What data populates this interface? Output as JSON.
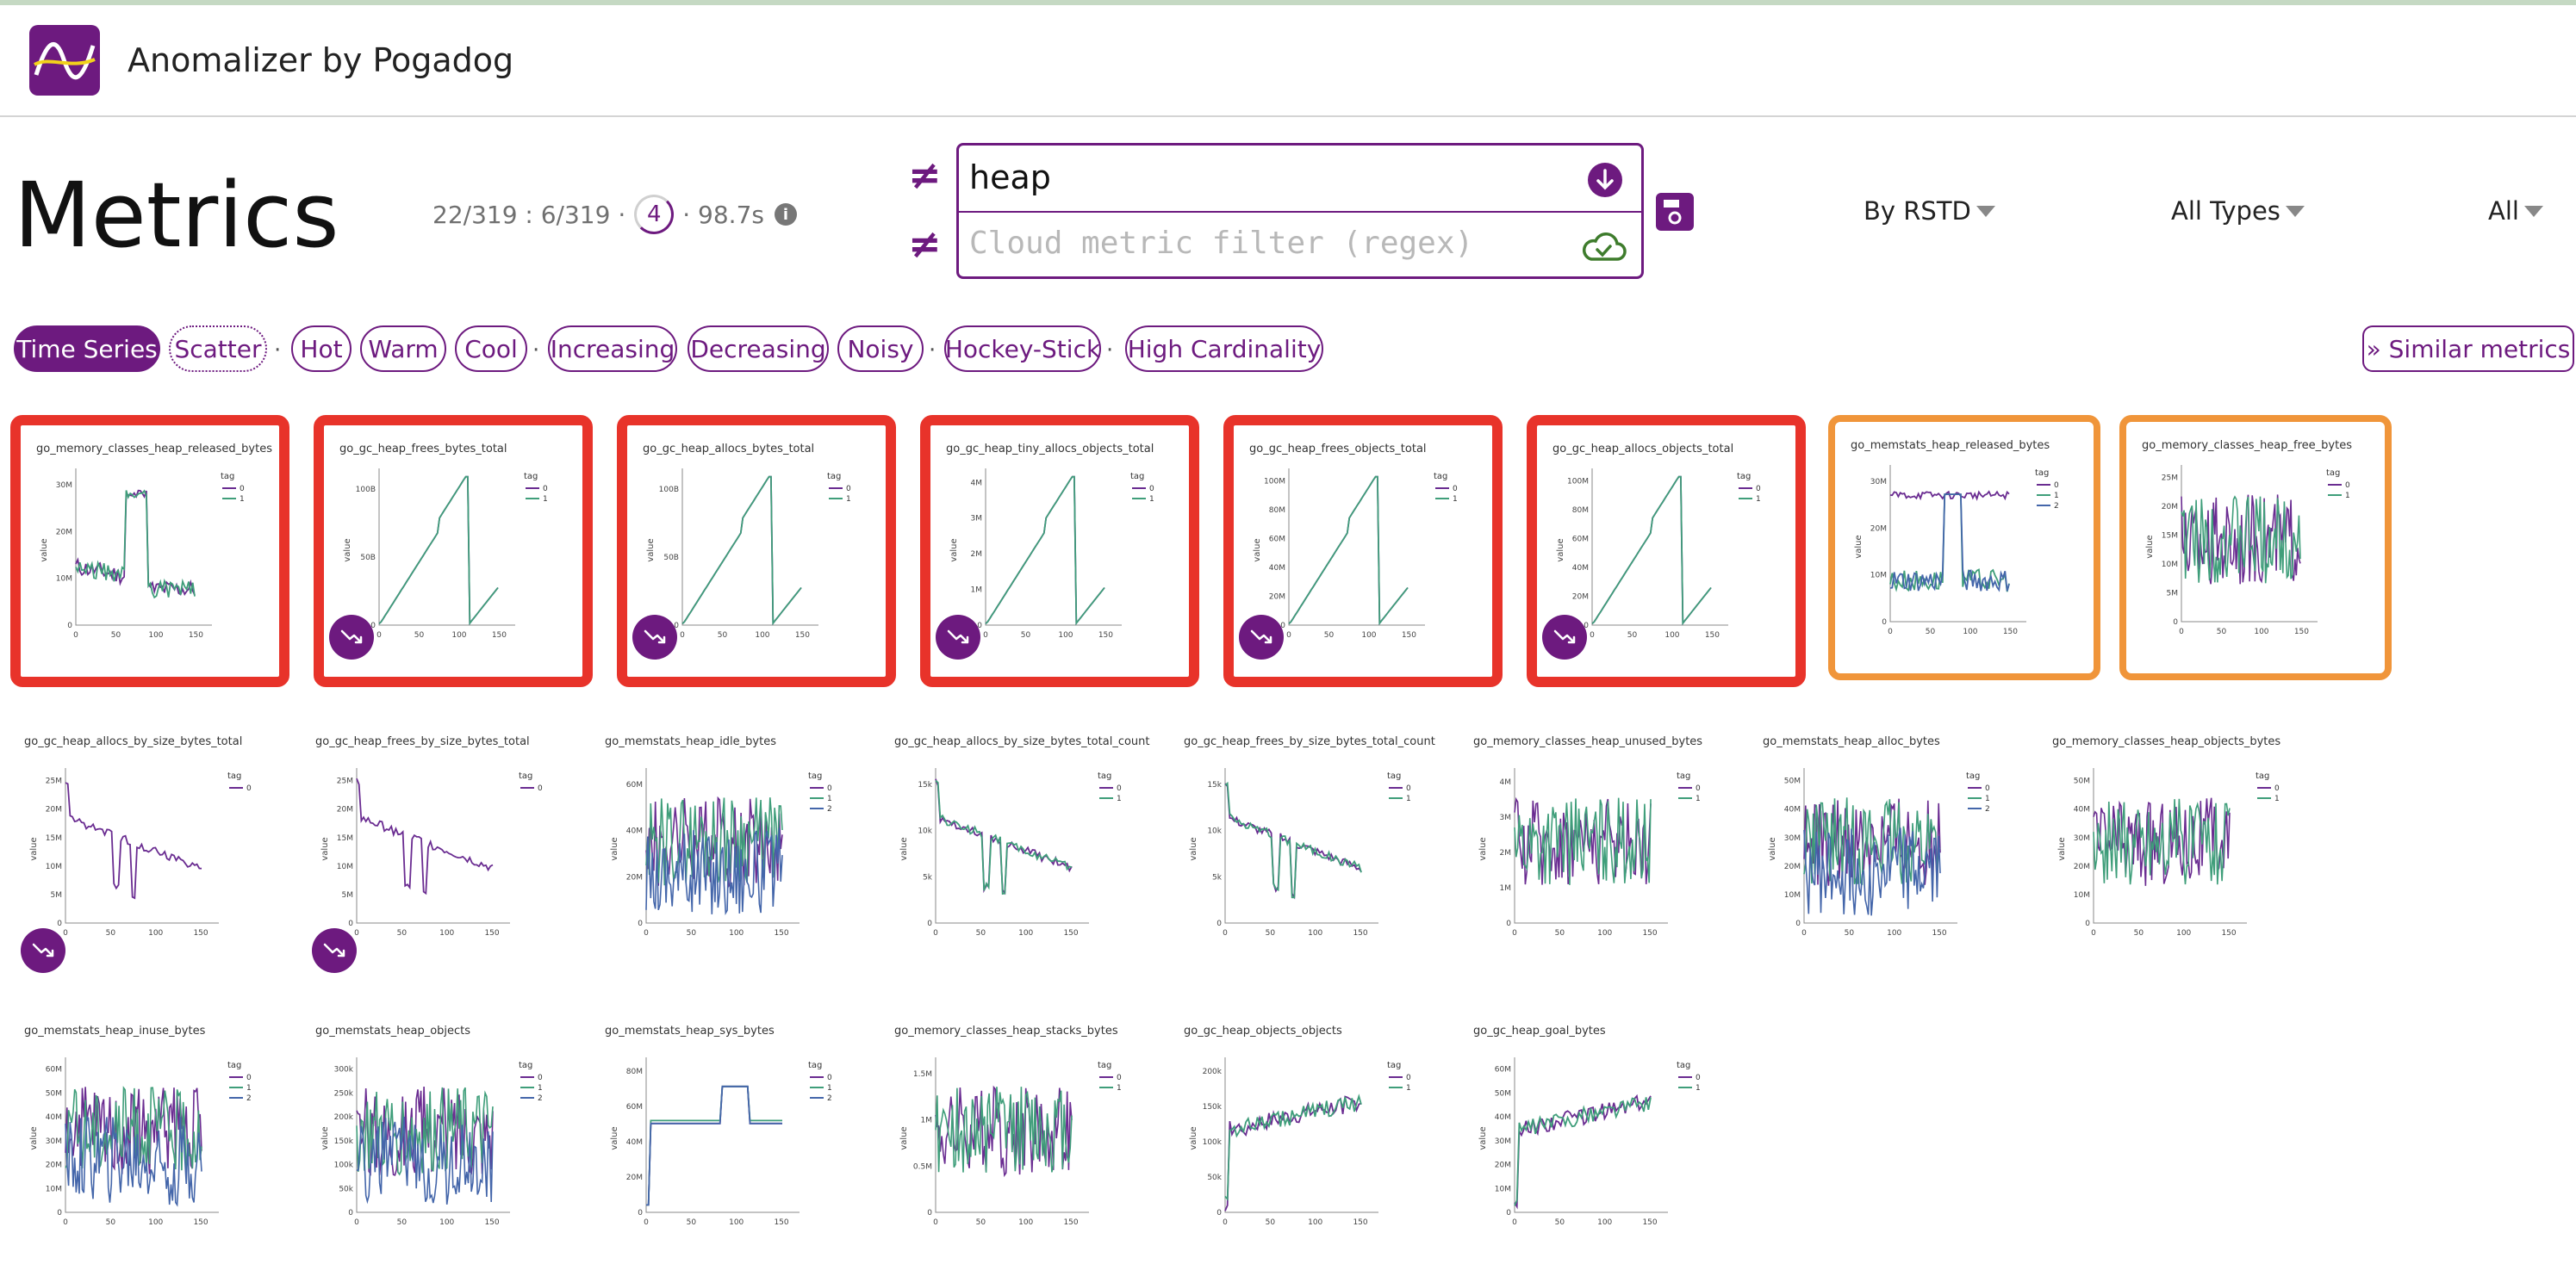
{
  "header": {
    "app_title": "Anomalizer by Pogadog"
  },
  "page": {
    "title": "Metrics"
  },
  "stats": {
    "counts": "22/319 : 6/319 ·",
    "ring_value": "4",
    "duration": "· 98.7s"
  },
  "filters": {
    "primary_value": "heap",
    "cloud_placeholder": "Cloud metric filter (regex)"
  },
  "dropdowns": {
    "sort": "By RSTD",
    "types": "All Types",
    "scope": "All"
  },
  "chips": [
    {
      "label": "Time Series"
    },
    {
      "label": "Scatter"
    },
    {
      "label": "Hot"
    },
    {
      "label": "Warm"
    },
    {
      "label": "Cool"
    },
    {
      "label": "Increasing"
    },
    {
      "label": "Decreasing"
    },
    {
      "label": "Noisy"
    },
    {
      "label": "Hockey-Stick"
    },
    {
      "label": "High Cardinality"
    }
  ],
  "separator": "·",
  "similar_button": "» Similar metrics",
  "legend": {
    "title": "tag",
    "labels": [
      "0",
      "1",
      "2"
    ]
  },
  "axis": {
    "ylabel": "value",
    "xticks": [
      "0",
      "50",
      "100",
      "150"
    ]
  },
  "colors": {
    "brand": "#6d1a7f",
    "red": "#e8332a",
    "orange": "#f0953a",
    "series": [
      "#6a2c91",
      "#3f9e7a",
      "#4466aa"
    ]
  },
  "metrics": [
    {
      "name": "go_memory_classes_heap_released_bytes",
      "yticks": [
        "10M",
        "20M",
        "30M"
      ],
      "series": 2,
      "shape": "step",
      "highlight": "red",
      "badge": false
    },
    {
      "name": "go_gc_heap_frees_bytes_total",
      "yticks": [
        "50B",
        "100B"
      ],
      "series": 2,
      "shape": "saw",
      "highlight": "red",
      "badge": true
    },
    {
      "name": "go_gc_heap_allocs_bytes_total",
      "yticks": [
        "50B",
        "100B"
      ],
      "series": 2,
      "shape": "saw",
      "highlight": "red",
      "badge": true
    },
    {
      "name": "go_gc_heap_tiny_allocs_objects_total",
      "yticks": [
        "1M",
        "2M",
        "3M",
        "4M"
      ],
      "series": 2,
      "shape": "saw",
      "highlight": "red",
      "badge": true
    },
    {
      "name": "go_gc_heap_frees_objects_total",
      "yticks": [
        "20M",
        "40M",
        "60M",
        "80M",
        "100M"
      ],
      "series": 2,
      "shape": "saw",
      "highlight": "red",
      "badge": true
    },
    {
      "name": "go_gc_heap_allocs_objects_total",
      "yticks": [
        "20M",
        "40M",
        "60M",
        "80M",
        "100M"
      ],
      "series": 2,
      "shape": "saw",
      "highlight": "red",
      "badge": true
    },
    {
      "name": "go_memstats_heap_released_bytes",
      "yticks": [
        "10M",
        "20M",
        "30M"
      ],
      "series": 3,
      "shape": "step2",
      "highlight": "orange",
      "badge": false
    },
    {
      "name": "go_memory_classes_heap_free_bytes",
      "yticks": [
        "5M",
        "10M",
        "15M",
        "20M",
        "25M"
      ],
      "series": 2,
      "shape": "noise",
      "highlight": "orange",
      "badge": false
    },
    {
      "name": "go_gc_heap_allocs_by_size_bytes_total",
      "yticks": [
        "5M",
        "10M",
        "15M",
        "20M",
        "25M"
      ],
      "series": 1,
      "shape": "decay",
      "highlight": "none",
      "badge": true
    },
    {
      "name": "go_gc_heap_frees_by_size_bytes_total",
      "yticks": [
        "5M",
        "10M",
        "15M",
        "20M",
        "25M"
      ],
      "series": 1,
      "shape": "decay",
      "highlight": "none",
      "badge": true
    },
    {
      "name": "go_memstats_heap_idle_bytes",
      "yticks": [
        "20M",
        "40M",
        "60M"
      ],
      "series": 3,
      "shape": "noise",
      "highlight": "none",
      "badge": false
    },
    {
      "name": "go_gc_heap_allocs_by_size_bytes_total_count",
      "yticks": [
        "5k",
        "10k",
        "15k"
      ],
      "series": 2,
      "shape": "decay",
      "highlight": "none",
      "badge": false
    },
    {
      "name": "go_gc_heap_frees_by_size_bytes_total_count",
      "yticks": [
        "5k",
        "10k",
        "15k"
      ],
      "series": 2,
      "shape": "decay",
      "highlight": "none",
      "badge": false
    },
    {
      "name": "go_memory_classes_heap_unused_bytes",
      "yticks": [
        "1M",
        "2M",
        "3M",
        "4M"
      ],
      "series": 2,
      "shape": "noise",
      "highlight": "none",
      "badge": false
    },
    {
      "name": "go_memstats_heap_alloc_bytes",
      "yticks": [
        "10M",
        "20M",
        "30M",
        "40M",
        "50M"
      ],
      "series": 3,
      "shape": "noise",
      "highlight": "none",
      "badge": false
    },
    {
      "name": "go_memory_classes_heap_objects_bytes",
      "yticks": [
        "10M",
        "20M",
        "30M",
        "40M",
        "50M"
      ],
      "series": 2,
      "shape": "noise",
      "highlight": "none",
      "badge": false
    },
    {
      "name": "go_memstats_heap_inuse_bytes",
      "yticks": [
        "10M",
        "20M",
        "30M",
        "40M",
        "50M",
        "60M"
      ],
      "series": 3,
      "shape": "noise",
      "highlight": "none",
      "badge": false
    },
    {
      "name": "go_memstats_heap_objects",
      "yticks": [
        "50k",
        "100k",
        "150k",
        "200k",
        "250k",
        "300k"
      ],
      "series": 3,
      "shape": "noise",
      "highlight": "none",
      "badge": false
    },
    {
      "name": "go_memstats_heap_sys_bytes",
      "yticks": [
        "20M",
        "40M",
        "60M",
        "80M"
      ],
      "series": 3,
      "shape": "flatstep",
      "highlight": "none",
      "badge": false
    },
    {
      "name": "go_memory_classes_heap_stacks_bytes",
      "yticks": [
        "0.5M",
        "1M",
        "1.5M"
      ],
      "series": 2,
      "shape": "noise",
      "highlight": "none",
      "badge": false
    },
    {
      "name": "go_gc_heap_objects_objects",
      "yticks": [
        "50k",
        "100k",
        "150k",
        "200k"
      ],
      "series": 2,
      "shape": "rise",
      "highlight": "none",
      "badge": false
    },
    {
      "name": "go_gc_heap_goal_bytes",
      "yticks": [
        "10M",
        "20M",
        "30M",
        "40M",
        "50M",
        "60M"
      ],
      "series": 2,
      "shape": "rise",
      "highlight": "none",
      "badge": false
    }
  ]
}
